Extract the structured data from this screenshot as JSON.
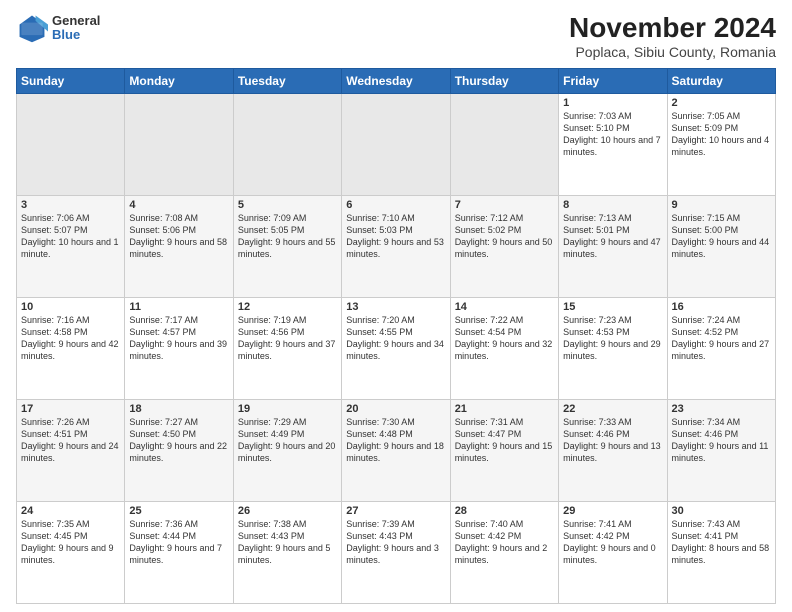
{
  "header": {
    "title": "November 2024",
    "subtitle": "Poplaca, Sibiu County, Romania",
    "logo_general": "General",
    "logo_blue": "Blue"
  },
  "weekdays": [
    "Sunday",
    "Monday",
    "Tuesday",
    "Wednesday",
    "Thursday",
    "Friday",
    "Saturday"
  ],
  "weeks": [
    [
      {
        "day": "",
        "info": ""
      },
      {
        "day": "",
        "info": ""
      },
      {
        "day": "",
        "info": ""
      },
      {
        "day": "",
        "info": ""
      },
      {
        "day": "",
        "info": ""
      },
      {
        "day": "1",
        "info": "Sunrise: 7:03 AM\nSunset: 5:10 PM\nDaylight: 10 hours and 7 minutes."
      },
      {
        "day": "2",
        "info": "Sunrise: 7:05 AM\nSunset: 5:09 PM\nDaylight: 10 hours and 4 minutes."
      }
    ],
    [
      {
        "day": "3",
        "info": "Sunrise: 7:06 AM\nSunset: 5:07 PM\nDaylight: 10 hours and 1 minute."
      },
      {
        "day": "4",
        "info": "Sunrise: 7:08 AM\nSunset: 5:06 PM\nDaylight: 9 hours and 58 minutes."
      },
      {
        "day": "5",
        "info": "Sunrise: 7:09 AM\nSunset: 5:05 PM\nDaylight: 9 hours and 55 minutes."
      },
      {
        "day": "6",
        "info": "Sunrise: 7:10 AM\nSunset: 5:03 PM\nDaylight: 9 hours and 53 minutes."
      },
      {
        "day": "7",
        "info": "Sunrise: 7:12 AM\nSunset: 5:02 PM\nDaylight: 9 hours and 50 minutes."
      },
      {
        "day": "8",
        "info": "Sunrise: 7:13 AM\nSunset: 5:01 PM\nDaylight: 9 hours and 47 minutes."
      },
      {
        "day": "9",
        "info": "Sunrise: 7:15 AM\nSunset: 5:00 PM\nDaylight: 9 hours and 44 minutes."
      }
    ],
    [
      {
        "day": "10",
        "info": "Sunrise: 7:16 AM\nSunset: 4:58 PM\nDaylight: 9 hours and 42 minutes."
      },
      {
        "day": "11",
        "info": "Sunrise: 7:17 AM\nSunset: 4:57 PM\nDaylight: 9 hours and 39 minutes."
      },
      {
        "day": "12",
        "info": "Sunrise: 7:19 AM\nSunset: 4:56 PM\nDaylight: 9 hours and 37 minutes."
      },
      {
        "day": "13",
        "info": "Sunrise: 7:20 AM\nSunset: 4:55 PM\nDaylight: 9 hours and 34 minutes."
      },
      {
        "day": "14",
        "info": "Sunrise: 7:22 AM\nSunset: 4:54 PM\nDaylight: 9 hours and 32 minutes."
      },
      {
        "day": "15",
        "info": "Sunrise: 7:23 AM\nSunset: 4:53 PM\nDaylight: 9 hours and 29 minutes."
      },
      {
        "day": "16",
        "info": "Sunrise: 7:24 AM\nSunset: 4:52 PM\nDaylight: 9 hours and 27 minutes."
      }
    ],
    [
      {
        "day": "17",
        "info": "Sunrise: 7:26 AM\nSunset: 4:51 PM\nDaylight: 9 hours and 24 minutes."
      },
      {
        "day": "18",
        "info": "Sunrise: 7:27 AM\nSunset: 4:50 PM\nDaylight: 9 hours and 22 minutes."
      },
      {
        "day": "19",
        "info": "Sunrise: 7:29 AM\nSunset: 4:49 PM\nDaylight: 9 hours and 20 minutes."
      },
      {
        "day": "20",
        "info": "Sunrise: 7:30 AM\nSunset: 4:48 PM\nDaylight: 9 hours and 18 minutes."
      },
      {
        "day": "21",
        "info": "Sunrise: 7:31 AM\nSunset: 4:47 PM\nDaylight: 9 hours and 15 minutes."
      },
      {
        "day": "22",
        "info": "Sunrise: 7:33 AM\nSunset: 4:46 PM\nDaylight: 9 hours and 13 minutes."
      },
      {
        "day": "23",
        "info": "Sunrise: 7:34 AM\nSunset: 4:46 PM\nDaylight: 9 hours and 11 minutes."
      }
    ],
    [
      {
        "day": "24",
        "info": "Sunrise: 7:35 AM\nSunset: 4:45 PM\nDaylight: 9 hours and 9 minutes."
      },
      {
        "day": "25",
        "info": "Sunrise: 7:36 AM\nSunset: 4:44 PM\nDaylight: 9 hours and 7 minutes."
      },
      {
        "day": "26",
        "info": "Sunrise: 7:38 AM\nSunset: 4:43 PM\nDaylight: 9 hours and 5 minutes."
      },
      {
        "day": "27",
        "info": "Sunrise: 7:39 AM\nSunset: 4:43 PM\nDaylight: 9 hours and 3 minutes."
      },
      {
        "day": "28",
        "info": "Sunrise: 7:40 AM\nSunset: 4:42 PM\nDaylight: 9 hours and 2 minutes."
      },
      {
        "day": "29",
        "info": "Sunrise: 7:41 AM\nSunset: 4:42 PM\nDaylight: 9 hours and 0 minutes."
      },
      {
        "day": "30",
        "info": "Sunrise: 7:43 AM\nSunset: 4:41 PM\nDaylight: 8 hours and 58 minutes."
      }
    ]
  ]
}
